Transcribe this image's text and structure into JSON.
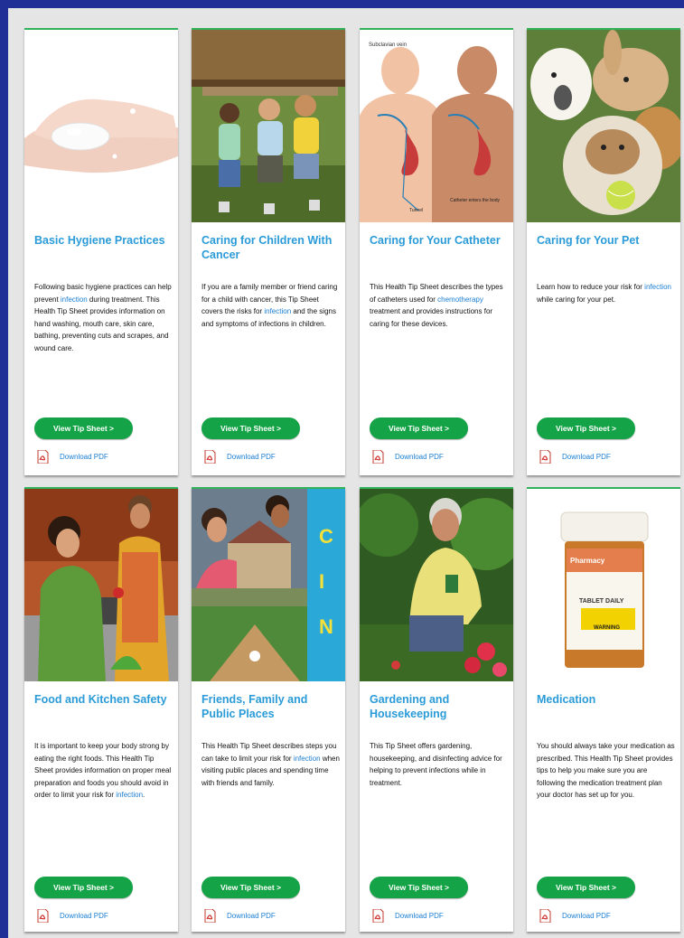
{
  "cards": [
    {
      "title": "Basic Hygiene Practices",
      "desc_before": "Following basic hygiene practices can help prevent ",
      "desc_link": "infection",
      "desc_after": " during treatment. This Health Tip Sheet provides information on hand washing, mouth care, skin care, bathing, preventing cuts and scrapes, and wound care.",
      "button": "View Tip Sheet >",
      "pdf": "Download PDF"
    },
    {
      "title": "Caring for Children With Cancer",
      "desc_before": "If you are a family member or friend caring for a child with cancer, this Tip Sheet covers the risks for ",
      "desc_link": "infection",
      "desc_after": " and the signs and symptoms of infections in children.",
      "button": "View Tip Sheet >",
      "pdf": "Download PDF"
    },
    {
      "title": "Caring for Your Catheter",
      "desc_before": "This Health Tip Sheet describes the types of catheters used for ",
      "desc_link": "chemotherapy",
      "desc_after": " treatment and provides instructions for caring for these devices.",
      "button": "View Tip Sheet >",
      "pdf": "Download PDF"
    },
    {
      "title": "Caring for Your Pet",
      "desc_before": "Learn how to reduce your risk for ",
      "desc_link": "infection",
      "desc_after": " while caring for your pet.",
      "button": "View Tip Sheet >",
      "pdf": "Download PDF"
    },
    {
      "title": "Food and Kitchen Safety",
      "desc_before": "It is important to keep your body strong by eating the right foods. This Health Tip Sheet provides information on proper meal preparation and foods you should avoid in order to limit your risk for ",
      "desc_link": "infection",
      "desc_after": ".",
      "button": "View Tip Sheet >",
      "pdf": "Download PDF"
    },
    {
      "title": "Friends, Family and Public Places",
      "desc_before": "This Health Tip Sheet describes steps you can take to limit your risk for ",
      "desc_link": "infection",
      "desc_after": " when visiting public places and spending time with friends and family.",
      "button": "View Tip Sheet >",
      "pdf": "Download PDF"
    },
    {
      "title": "Gardening and Housekeeping",
      "desc_before": "This Tip Sheet offers gardening, housekeeping, and disinfecting advice for helping to prevent infections while in treatment.",
      "desc_link": "",
      "desc_after": "",
      "button": "View Tip Sheet >",
      "pdf": "Download PDF"
    },
    {
      "title": "Medication",
      "desc_before": "You should always take your medication as prescribed. This Health Tip Sheet provides tips to help you make sure you are following the medication treatment plan your doctor has set up for you.",
      "desc_link": "",
      "desc_after": "",
      "button": "View Tip Sheet >",
      "pdf": "Download PDF"
    }
  ],
  "image_labels": {
    "catheter_top": "Subclavian vein",
    "catheter_right": "Catheter enters the body",
    "catheter_bottom": "Tunnel",
    "medication_pharmacy": "Pharmacy",
    "medication_daily": "TABLET DAILY",
    "medication_warning": "WARNING"
  },
  "colors": {
    "background": "#1f2f95",
    "panel": "#e5e5e5",
    "accent_green": "#15a347",
    "card_top_border": "#2fb25a",
    "title_blue": "#2a9bd8",
    "link_blue": "#1a7ed2"
  }
}
